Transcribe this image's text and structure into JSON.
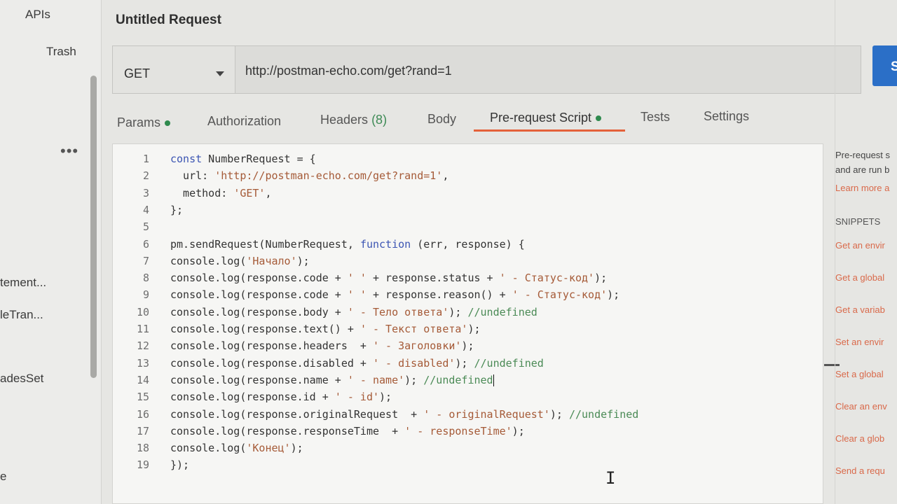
{
  "sidebar": {
    "apis": "APIs",
    "trash": "Trash",
    "more": "•••",
    "items": [
      "tement...",
      "leTran...",
      "adesSet",
      "e"
    ]
  },
  "request": {
    "title": "Untitled Request",
    "method": "GET",
    "url": "http://postman-echo.com/get?rand=1",
    "send_label": "S"
  },
  "tabs": {
    "params": "Params",
    "authorization": "Authorization",
    "headers": "Headers",
    "headers_count": "(8)",
    "body": "Body",
    "prerequest": "Pre-request Script",
    "tests": "Tests",
    "settings": "Settings",
    "active": "Pre-request Script"
  },
  "editor": {
    "lines": [
      {
        "n": "1",
        "t": "const NumberRequest = {"
      },
      {
        "n": "2",
        "t": "  url: 'http://postman-echo.com/get?rand=1',"
      },
      {
        "n": "3",
        "t": "  method: 'GET',"
      },
      {
        "n": "4",
        "t": "};"
      },
      {
        "n": "5",
        "t": ""
      },
      {
        "n": "6",
        "t": "pm.sendRequest(NumberRequest, function (err, response) {"
      },
      {
        "n": "7",
        "t": "console.log('Начало');"
      },
      {
        "n": "8",
        "t": "console.log(response.code + ' ' + response.status + ' - Статус-код');"
      },
      {
        "n": "9",
        "t": "console.log(response.code + ' ' + response.reason() + ' - Статус-код');"
      },
      {
        "n": "10",
        "t": "console.log(response.body + ' - Тело ответа'); //undefined"
      },
      {
        "n": "11",
        "t": "console.log(response.text() + ' - Текст ответа');"
      },
      {
        "n": "12",
        "t": "console.log(response.headers  + ' - Заголовки');"
      },
      {
        "n": "13",
        "t": "console.log(response.disabled + ' - disabled'); //undefined"
      },
      {
        "n": "14",
        "t": "console.log(response.name + ' - name'); //undefined"
      },
      {
        "n": "15",
        "t": "console.log(response.id + ' - id');"
      },
      {
        "n": "16",
        "t": "console.log(response.originalRequest  + ' - originalRequest'); //undefined"
      },
      {
        "n": "17",
        "t": "console.log(response.responseTime  + ' - responseTime');"
      },
      {
        "n": "18",
        "t": "console.log('Конец');"
      },
      {
        "n": "19",
        "t": "});"
      }
    ]
  },
  "right_panel": {
    "desc_1": "Pre-request s",
    "desc_2": "and are run b",
    "learn_more": "Learn more a",
    "snippets_heading": "SNIPPETS",
    "snippets": [
      "Get an envir",
      "Get a global",
      "Get a variab",
      "Set an envir",
      "Set a global",
      "Clear an env",
      "Clear a glob",
      "Send a requ"
    ]
  },
  "colors": {
    "accent": "#e4613a",
    "send_button": "#2b6fc7",
    "status_dot": "#2f8a4e",
    "keyword": "#3c55b3",
    "string": "#a55a37",
    "comment": "#4a8a55",
    "snippet_link": "#d9694a"
  }
}
